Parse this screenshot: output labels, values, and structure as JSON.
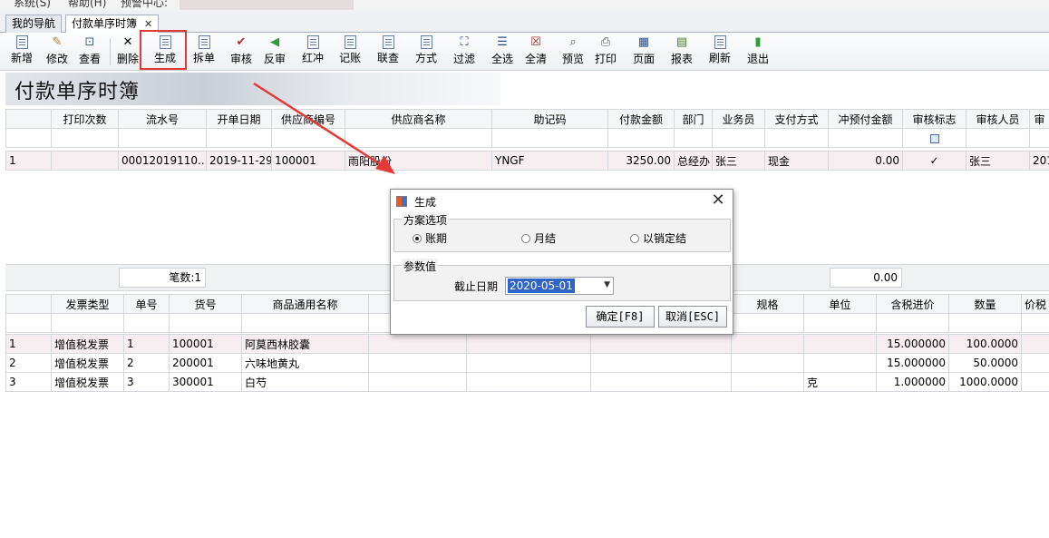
{
  "menubar": {
    "items": [
      "系统(S)",
      "帮助(H)",
      "预警中心:"
    ]
  },
  "tabs": [
    {
      "label": "我的导航"
    },
    {
      "label": "付款单序时簿",
      "close": "✕"
    }
  ],
  "toolbar": {
    "buttons": [
      {
        "label": "新增",
        "icon": "new-doc-icon"
      },
      {
        "label": "修改",
        "icon": "edit-icon"
      },
      {
        "label": "查看",
        "icon": "view-icon"
      },
      {
        "label": "删除",
        "icon": "delete-icon"
      },
      {
        "label": "生成",
        "icon": "generate-icon"
      },
      {
        "label": "拆单",
        "icon": "split-icon"
      },
      {
        "label": "审核",
        "icon": "approve-icon"
      },
      {
        "label": "反审",
        "icon": "unapprove-icon"
      },
      {
        "label": "红冲",
        "icon": "red-reverse-icon"
      },
      {
        "label": "记账",
        "icon": "post-icon"
      },
      {
        "label": "联查",
        "icon": "link-query-icon"
      },
      {
        "label": "方式",
        "icon": "mode-icon"
      },
      {
        "label": "过滤",
        "icon": "filter-icon"
      },
      {
        "label": "全选",
        "icon": "select-all-icon"
      },
      {
        "label": "全清",
        "icon": "clear-all-icon"
      },
      {
        "label": "预览",
        "icon": "preview-icon"
      },
      {
        "label": "打印",
        "icon": "print-icon"
      },
      {
        "label": "页面",
        "icon": "page-icon"
      },
      {
        "label": "报表",
        "icon": "report-icon"
      },
      {
        "label": "刷新",
        "icon": "refresh-icon"
      },
      {
        "label": "退出",
        "icon": "exit-icon"
      }
    ]
  },
  "banner": {
    "title": "付款单序时簿"
  },
  "top_grid": {
    "headers": [
      "",
      "打印次数",
      "流水号",
      "开单日期",
      "供应商编号",
      "供应商名称",
      "助记码",
      "付款金额",
      "部门",
      "业务员",
      "支付方式",
      "冲预付金额",
      "审核标志",
      "审核人员",
      "审"
    ],
    "rows": [
      [
        "1",
        "",
        "00012019110...",
        "2019-11-29",
        "100001",
        "雨阳股份",
        "YNGF",
        "3250.00",
        "总经办",
        "张三",
        "现金",
        "0.00",
        "✓",
        "张三",
        "201"
      ]
    ]
  },
  "summary": {
    "count_label": "笔数:1",
    "total": "0.00"
  },
  "bottom_grid": {
    "headers": [
      "",
      "发票类型",
      "单号",
      "货号",
      "商品通用名称",
      "",
      "",
      "",
      "规格",
      "单位",
      "含税进价",
      "数量",
      "价税"
    ],
    "rows": [
      [
        "1",
        "增值税发票",
        "1",
        "100001",
        "阿莫西林胶囊",
        "",
        "",
        "",
        "",
        "",
        "15.000000",
        "100.0000",
        ""
      ],
      [
        "2",
        "增值税发票",
        "2",
        "200001",
        "六味地黄丸",
        "",
        "",
        "",
        "",
        "",
        "15.000000",
        "50.0000",
        ""
      ],
      [
        "3",
        "增值税发票",
        "3",
        "300001",
        "白芍",
        "",
        "",
        "",
        "",
        "克",
        "1.000000",
        "1000.0000",
        ""
      ]
    ]
  },
  "dialog": {
    "title": "生成",
    "scheme_legend": "方案选项",
    "options": [
      {
        "label": "账期",
        "checked": true
      },
      {
        "label": "月结",
        "checked": false
      },
      {
        "label": "以销定结",
        "checked": false
      }
    ],
    "param_legend": "参数值",
    "cutoff_label": "截止日期",
    "cutoff_value": "2020-05-01",
    "ok_label": "确定[F8]",
    "cancel_label": "取消[ESC]"
  },
  "colors": {
    "highlight": "#e53935",
    "selection": "#2f64c9"
  }
}
